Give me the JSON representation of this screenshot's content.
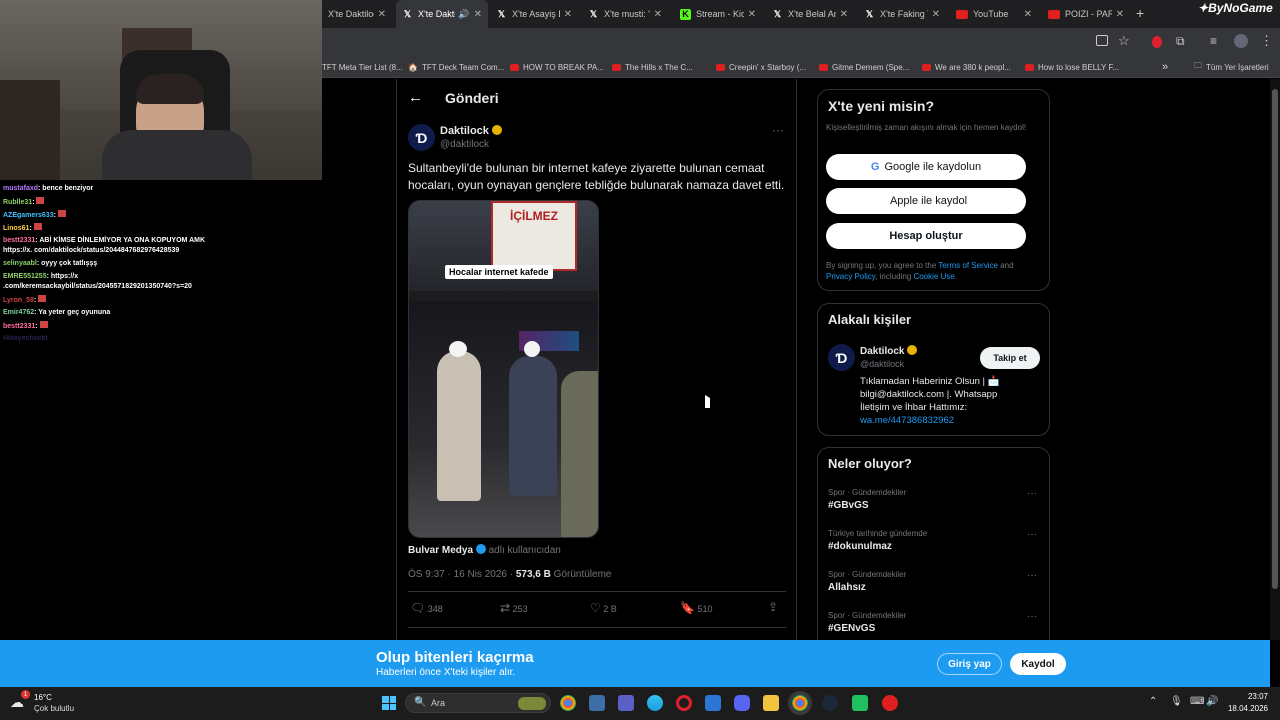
{
  "browser": {
    "tabs": [
      {
        "title": "X'te Daktilock",
        "favicon": "x-icon"
      },
      {
        "title": "X'te Daktilock",
        "favicon": "x-icon"
      },
      {
        "title": "X'te Asayiş B",
        "favicon": "x-icon"
      },
      {
        "title": "X'te musti: \"",
        "favicon": "x-icon"
      },
      {
        "title": "Stream - Kick",
        "favicon": "kick-icon"
      },
      {
        "title": "X'te Belal An",
        "favicon": "x-icon"
      },
      {
        "title": "X'te Faking T",
        "favicon": "x-icon"
      },
      {
        "title": "YouTube",
        "favicon": "youtube-icon"
      },
      {
        "title": "POIZI - PARL",
        "favicon": "youtube-icon"
      }
    ],
    "new_tab": "+",
    "bookmarks": [
      "TFT Meta Tier List (8...",
      "TFT Deck Team Com...",
      "HOW TO BREAK PA...",
      "The Hills x The C...",
      "Creepin' x Starboy (...",
      "Gitme Demem (Spe...",
      "We are 380 k peopl...",
      "How to lose BELLY F..."
    ],
    "bookmarks_more": "»",
    "all_bookmarks": "Tüm Yer İşaretleri"
  },
  "stream_overlay": {
    "watermark": "ByNoGame",
    "chat": [
      {
        "user": "mustafaxd",
        "text": "bence benziyor",
        "color": "#b57bff"
      },
      {
        "user": "Rublle31",
        "text": "",
        "color": "#8fd16b"
      },
      {
        "user": "AZEgamers633",
        "text": "",
        "color": "#3ec0ff"
      },
      {
        "user": "Linos61",
        "text": "",
        "color": "#ffd23e"
      },
      {
        "user": "bestt2331",
        "text": "ABİ KİMSE DİNLEMİYOR YA ONA KOPUYOM AMK",
        "color": "#ff6b9a"
      },
      {
        "user": "",
        "text": "https://x. com/daktilock/status/2044847682976428539",
        "color": "#ffffff"
      },
      {
        "user": "selinyaabl",
        "text": "oyyy çok tatlışşş",
        "color": "#8fd16b"
      },
      {
        "user": "EMRE551255",
        "text": "https://x",
        "color": "#8fd16b"
      },
      {
        "user": "",
        "text": ".com/keremsackaybil/status/2045571829201350740?s=20",
        "color": "#ffffff"
      },
      {
        "user": "Lyron_59",
        "text": "",
        "color": "#c44"
      },
      {
        "user": "Emir4762",
        "text": "Ya yeter geç oyununa",
        "color": "#7fd0a0"
      },
      {
        "user": "bestt2331",
        "text": "",
        "color": "#ff6b9a"
      },
      {
        "user": "Hikayecheckt",
        "text": "",
        "color": "#5a3fa0"
      }
    ]
  },
  "post": {
    "header_title": "Gönderi",
    "author_name": "Daktilock",
    "author_handle": "@daktilock",
    "text": "Sultanbeyli'de bulunan bir internet kafeye ziyarette bulunan cemaat hocaları, oyun oynayan gençlere tebliğde bulunarak namaza davet etti.",
    "media_caption": "Hocalar internet kafede",
    "media_sign": "İÇİLMEZ",
    "source_name": "Bulvar Medya",
    "source_suffix": "adlı kullanıcıdan",
    "meta_time": "ÖS 9:37 · 16 Nis 2026 · ",
    "meta_views_num": "573,6 B",
    "meta_views_label": " Görüntüleme",
    "actions": {
      "replies": "348",
      "reposts": "253",
      "likes": "2 B",
      "bookmarks": "510"
    }
  },
  "sidebar": {
    "signup": {
      "title": "X'te yeni misin?",
      "subtitle": "Kişiselleştirilmiş zaman akışını almak için hemen kaydol!",
      "google_btn": "Google ile kaydolun",
      "apple_btn": "Apple ile kaydol",
      "create_btn": "Hesap oluştur",
      "legal_prefix": "By signing up, you agree to the ",
      "legal_terms": "Terms of Service",
      "legal_and": " and ",
      "legal_privacy": "Privacy Policy",
      "legal_including": ", including ",
      "legal_cookie": "Cookie Use",
      "legal_end": "."
    },
    "related": {
      "title": "Alakalı kişiler",
      "name": "Daktilock",
      "handle": "@daktilock",
      "follow_btn": "Takip et",
      "bio": "Tıklamadan Haberiniz Olsun | 📩 bilgi@daktilock.com |. Whatsapp İletişim ve İhbar Hattımız:",
      "link": "wa.me/447386832962"
    },
    "trends": {
      "title": "Neler oluyor?",
      "items": [
        {
          "context": "Spor · Gündemdekiler",
          "tag": "#GBvGS"
        },
        {
          "context": "Türkiye tarihinde gündemde",
          "tag": "#dokunulmaz"
        },
        {
          "context": "Spor · Gündemdekiler",
          "tag": "Allahsız"
        },
        {
          "context": "Spor · Gündemdekiler",
          "tag": "#GENvGS"
        }
      ]
    }
  },
  "banner": {
    "title": "Olup bitenleri kaçırma",
    "subtitle": "Haberleri önce X'teki kişiler alır.",
    "login_btn": "Giriş yap",
    "signup_btn": "Kaydol"
  },
  "taskbar": {
    "weather_temp": "16°C",
    "weather_desc": "Çok bulutlu",
    "weather_badge": "1",
    "search_placeholder": "Ara",
    "time": "23:07",
    "date": "18.04.2026"
  },
  "colors": {
    "x_blue": "#1d9bf0",
    "bg": "#000000",
    "border": "#2f3336",
    "muted": "#71767b"
  }
}
